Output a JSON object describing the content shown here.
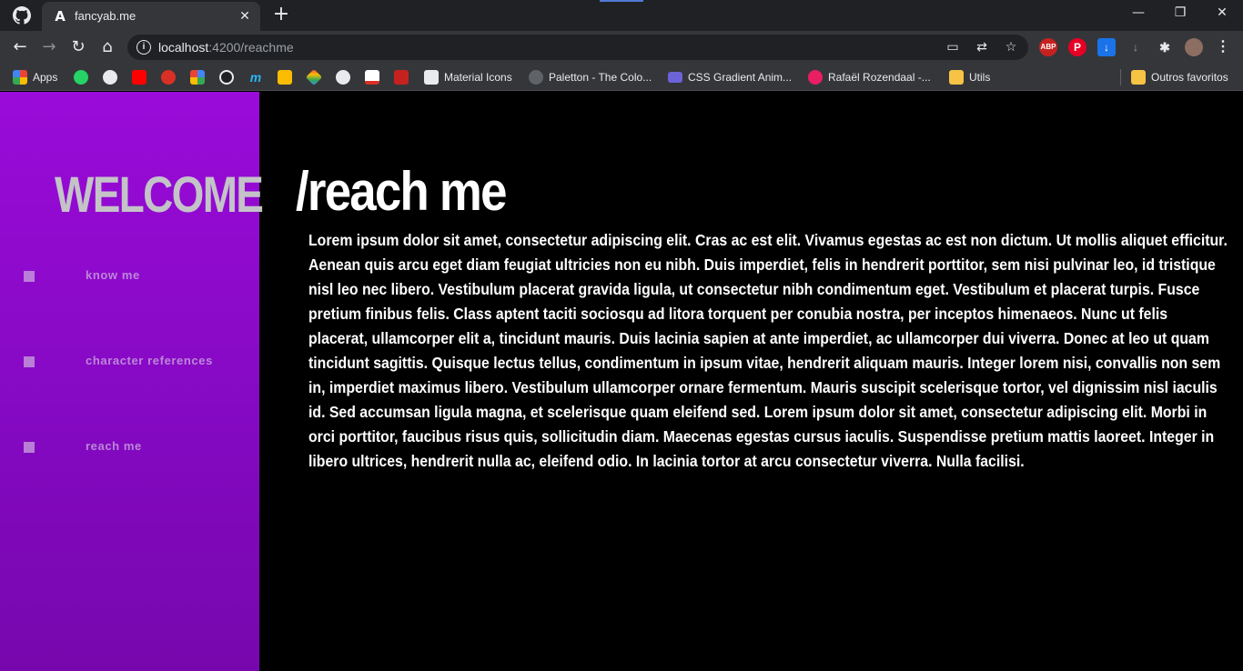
{
  "browser": {
    "tab": {
      "title": "fancyab.me",
      "favicon": "A"
    },
    "window_controls": {
      "minimize": "—",
      "restore": "❐",
      "close": "✕"
    },
    "omnibox": {
      "host": "localhost",
      "rest": ":4200/reachme"
    },
    "bookmarks": [
      {
        "label": "Apps",
        "icon": "apps-grid-icon"
      },
      {
        "label": "Material Icons",
        "icon": "material-icons-icon"
      },
      {
        "label": "Paletton - The Colo...",
        "icon": "paletton-icon"
      },
      {
        "label": "CSS Gradient Anim...",
        "icon": "css-gradient-icon"
      },
      {
        "label": "Rafaël Rozendaal -...",
        "icon": "rozendaal-icon"
      },
      {
        "label": "Utils",
        "icon": "folder-icon"
      },
      {
        "label": "Outros favoritos",
        "icon": "folder-icon"
      }
    ],
    "extension_labels": {
      "abp": "ABP"
    },
    "colors": {
      "tabstrip": "#202124",
      "toolbar": "#35363a"
    }
  },
  "sidebar": {
    "welcome": "WELCOME",
    "items": [
      {
        "label": "know me"
      },
      {
        "label": "character references"
      },
      {
        "label": "reach me"
      }
    ],
    "colors": {
      "gradient_top": "#9a0bd9",
      "gradient_bottom": "#7707ad"
    }
  },
  "main": {
    "title": "/reach me",
    "body": "Lorem ipsum dolor sit amet, consectetur adipiscing elit. Cras ac est elit. Vivamus egestas ac est non dictum. Ut mollis aliquet efficitur. Aenean quis arcu eget diam feugiat ultricies non eu nibh. Duis imperdiet, felis in hendrerit porttitor, sem nisi pulvinar leo, id tristique nisl leo nec libero. Vestibulum placerat gravida ligula, ut consectetur nibh condimentum eget. Vestibulum et placerat turpis. Fusce pretium finibus felis. Class aptent taciti sociosqu ad litora torquent per conubia nostra, per inceptos himenaeos. Nunc ut felis placerat, ullamcorper elit a, tincidunt mauris. Duis lacinia sapien at ante imperdiet, ac ullamcorper dui viverra. Donec at leo ut quam tincidunt sagittis. Quisque lectus tellus, condimentum in ipsum vitae, hendrerit aliquam mauris. Integer lorem nisi, convallis non sem in, imperdiet maximus libero. Vestibulum ullamcorper ornare fermentum. Mauris suscipit scelerisque tortor, vel dignissim nisl iaculis id. Sed accumsan ligula magna, et scelerisque quam eleifend sed. Lorem ipsum dolor sit amet, consectetur adipiscing elit. Morbi in orci porttitor, faucibus risus quis, sollicitudin diam. Maecenas egestas cursus iaculis. Suspendisse pretium mattis laoreet. Integer in libero ultrices, hendrerit nulla ac, eleifend odio. In lacinia tortor at arcu consectetur viverra. Nulla facilisi."
  }
}
